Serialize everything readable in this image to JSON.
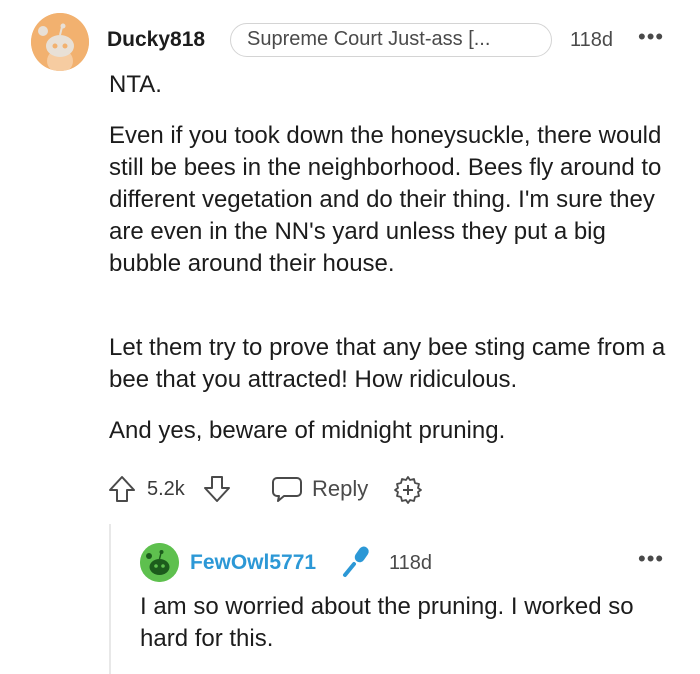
{
  "comment": {
    "username": "Ducky818",
    "flair": "Supreme Court Just-ass [...",
    "age": "118d",
    "more_label": "•••",
    "paragraphs": [
      "NTA.",
      "Even if you took down the honeysuckle, there would still be bees in the neighborhood. Bees fly around to different vegetation and do their thing. I'm sure they are even in the NN's yard unless they put a big bubble around their house.",
      "Let them try to prove that any bee sting came from a bee that you attracted! How ridiculous.",
      "And yes, beware of midnight pruning."
    ],
    "score": "5.2k",
    "reply_label": "Reply",
    "avatar_color": "#f2b16f"
  },
  "reply": {
    "username": "FewOwl5771",
    "age": "118d",
    "more_label": "•••",
    "text": "I am so worried about the pruning. I worked so hard for this.",
    "username_color": "#2c98d6",
    "avatar_color": "#5ec04e"
  }
}
